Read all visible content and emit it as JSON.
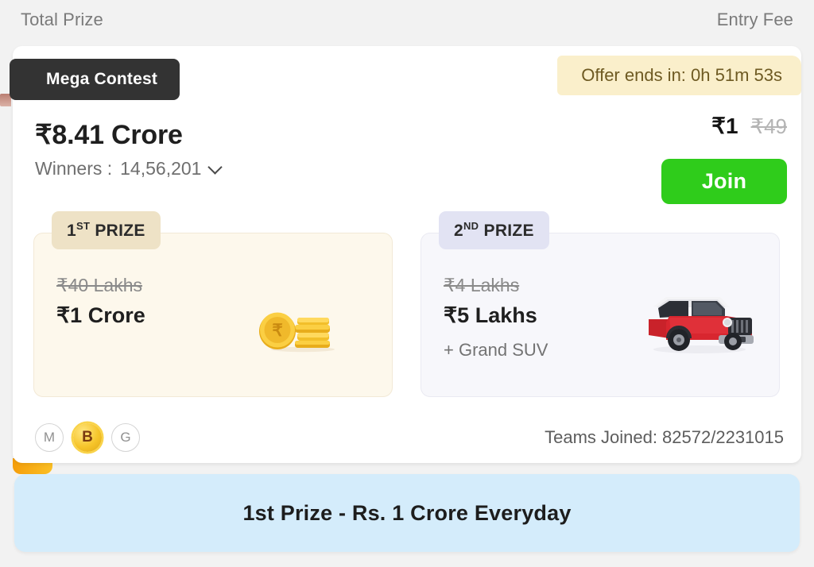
{
  "header": {
    "total_prize_label": "Total Prize",
    "entry_fee_label": "Entry Fee"
  },
  "card": {
    "contest_tag": "Mega Contest",
    "offer_timer": "Offer ends in: 0h 51m 53s",
    "total_prize_amount": "₹8.41 Crore",
    "winners_label": "Winners :",
    "winners_count": "14,56,201",
    "chevron_icon": "chevron-down-icon",
    "entry_fee_current": "₹1",
    "entry_fee_original": "₹49",
    "join_label": "Join",
    "teams_joined": "Teams Joined: 82572/2231015"
  },
  "prizes": [
    {
      "rank_number": "1",
      "rank_suffix": "ST",
      "rank_word": "PRIZE",
      "old_amount": "₹40 Lakhs",
      "new_amount": "₹1 Crore",
      "extra": "",
      "icon": "gold-coins-icon",
      "badge_color": "#eee2c6",
      "card_color": "#fdf8ec"
    },
    {
      "rank_number": "2",
      "rank_suffix": "ND",
      "rank_word": "PRIZE",
      "old_amount": "₹4 Lakhs",
      "new_amount": "₹5 Lakhs",
      "extra": "+ Grand SUV",
      "icon": "red-suv-icon",
      "badge_color": "#e2e3f3",
      "card_color": "#f7f7fb"
    }
  ],
  "badges": [
    {
      "letter": "M",
      "style": "outline"
    },
    {
      "letter": "B",
      "style": "gold"
    },
    {
      "letter": "G",
      "style": "outline"
    }
  ],
  "promo": {
    "text": "1st Prize - Rs. 1 Crore Everyday"
  },
  "colors": {
    "page_background": "#f2f2f2",
    "card_background": "#ffffff",
    "join_green": "#2fcc1b",
    "offer_yellow": "#faefcb",
    "promo_blue": "#d4ecfb",
    "tag_dark": "#333333",
    "orange_tab": "#f59e0b"
  }
}
